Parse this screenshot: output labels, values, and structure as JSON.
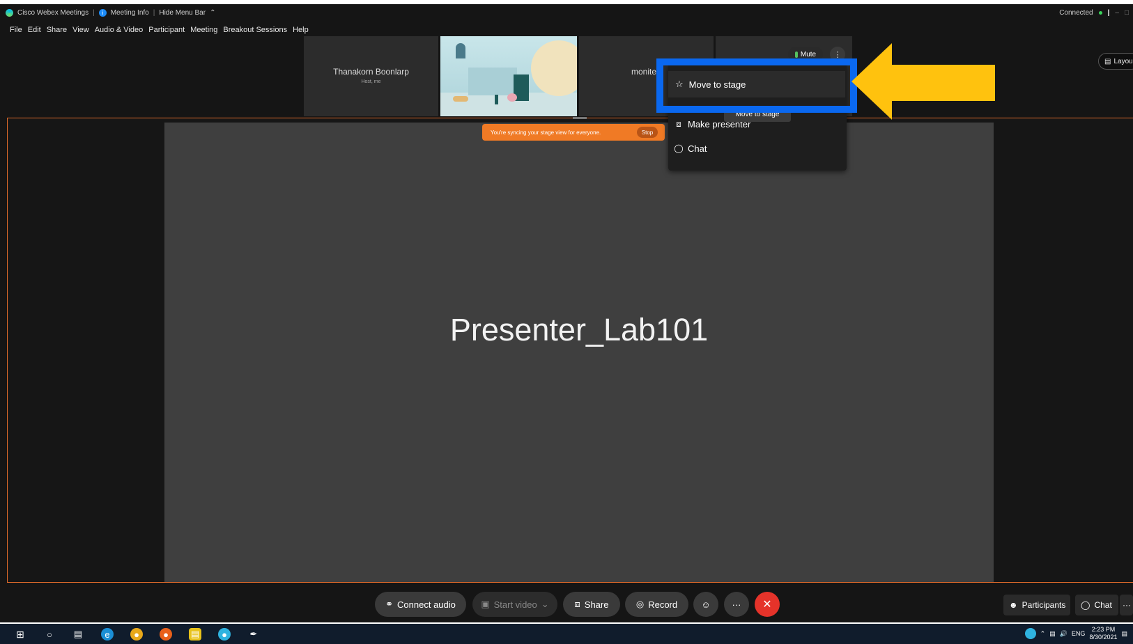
{
  "titlebar": {
    "app_name": "Cisco Webex Meetings",
    "meeting_info": "Meeting Info",
    "hide_menu": "Hide Menu Bar",
    "hide_menu_icon": "chevron-up-icon",
    "status": "Connected",
    "status_color": "#3ad35a"
  },
  "menubar": {
    "items": [
      "File",
      "Edit",
      "Share",
      "View",
      "Audio & Video",
      "Participant",
      "Meeting",
      "Breakout Sessions",
      "Help"
    ]
  },
  "thumbnails": {
    "host_name": "Thanakorn Boonlarp",
    "host_role": "Host, me",
    "third_name": "monite",
    "mute_label": "Mute",
    "more_label": "⋮"
  },
  "layout_button": {
    "label": "Layou"
  },
  "sync_banner": {
    "text": "You're syncing your stage view for everyone.",
    "stop_label": "Stop",
    "color": "#f07a25"
  },
  "context_menu": {
    "items": [
      {
        "label": "Move to stage",
        "icon": "pin-icon"
      },
      {
        "label": "Make presenter",
        "icon": "share-icon"
      },
      {
        "label": "Chat",
        "icon": "chat-icon"
      }
    ],
    "tooltip": "Move to stage"
  },
  "stage": {
    "title": "Presenter_Lab101"
  },
  "annotation": {
    "box_color": "#0a68f0",
    "arrow_color": "#ffc20e"
  },
  "controls": {
    "connect_audio": "Connect audio",
    "start_video": "Start video",
    "share": "Share",
    "record": "Record",
    "participants": "Participants",
    "chat": "Chat",
    "more": "···",
    "end_color": "#e5332a"
  },
  "taskbar": {
    "language": "ENG",
    "time": "2:23 PM",
    "date": "8/30/2021"
  }
}
